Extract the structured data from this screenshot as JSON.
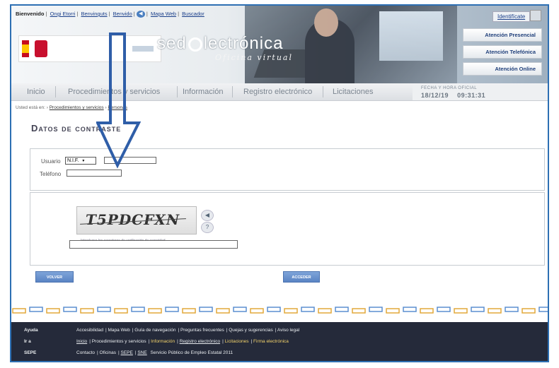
{
  "header": {
    "welcome_label": "Bienvenido",
    "welcome_links": [
      "Ongi Etorri",
      "Benvinguts",
      "Benvido"
    ],
    "top_links": [
      "Mapa Web",
      "Buscador"
    ],
    "brand_pre": "sed",
    "brand_post": "lectrónica",
    "brand_tagline": "Oficina virtual",
    "identificate": "Identifícate",
    "atencion": [
      "Atención Presencial",
      "Atención Telefónica",
      "Atención Online"
    ]
  },
  "nav": {
    "tabs": [
      "Inicio",
      "Procedimientos y servicios",
      "Información",
      "Registro electrónico",
      "Licitaciones"
    ],
    "fecha_label": "FECHA Y HORA OFICIAL",
    "fecha_value": "18/12/19",
    "hora_value": "09:31:31"
  },
  "breadcrumb": {
    "prefix": "Usted está en:",
    "items": [
      "Procedimientos y servicios",
      "Personas"
    ]
  },
  "main": {
    "title": "Datos de contraste",
    "usuario_label": "Usuario",
    "doc_type": "N.I.F.",
    "usuario_value": "",
    "telefono_label": "Teléfono",
    "telefono_value": "",
    "captcha_text": "T5PDCFXN",
    "captcha_hint": "Introduzca los caracteres de verificación de seguridad",
    "captcha_value": "",
    "back_button": "VOLVER",
    "submit_button": "ACCEDER"
  },
  "footer": {
    "rows": [
      {
        "heading": "Ayuda",
        "links": [
          "Accesibilidad",
          "Mapa Web",
          "Guía de navegación",
          "Preguntas frecuentes",
          "Quejas y sugerencias",
          "Aviso legal"
        ]
      },
      {
        "heading": "Ir a",
        "links": [
          "Inicio",
          "Procedimientos y servicios",
          "Información",
          "Registro electrónico",
          "Licitaciones",
          "Firma electrónica"
        ]
      },
      {
        "heading": "SEPE",
        "links": [
          "Contacto",
          "Oficinas",
          "SEPE",
          "SNE",
          "Servicio Público de Empleo Estatal 2011"
        ]
      }
    ]
  },
  "colors": {
    "frame_border": "#2d6fb3",
    "arrow": "#2f5ea8",
    "button": "#6a93d0",
    "footer_bg": "#252a3a"
  }
}
